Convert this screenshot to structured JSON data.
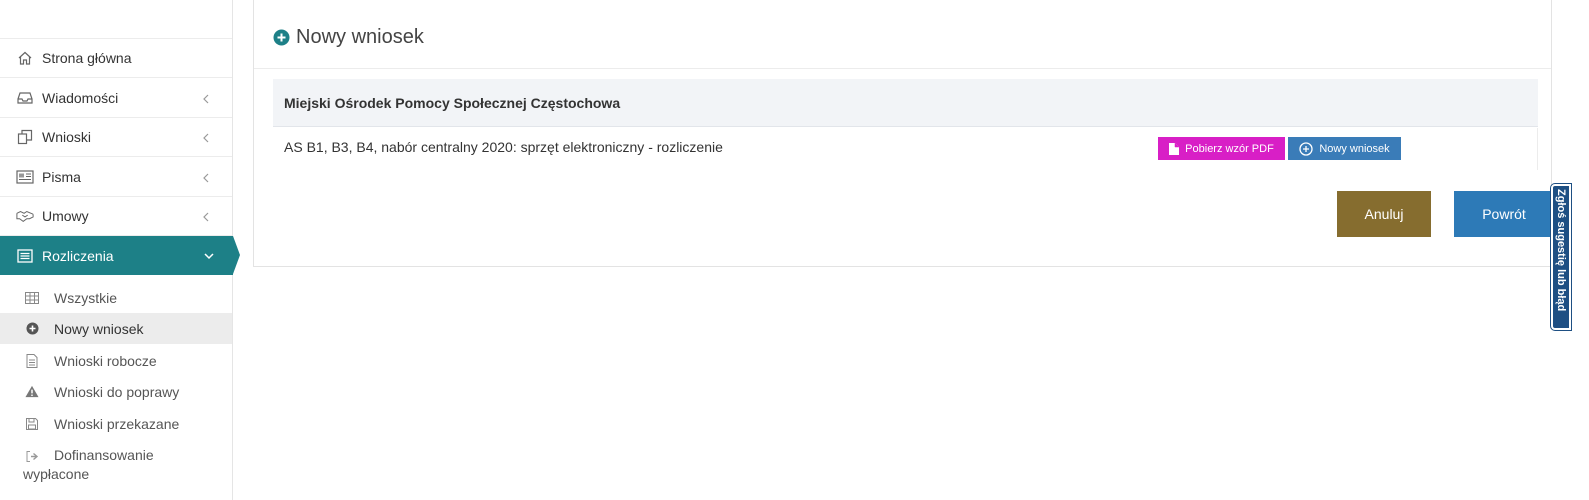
{
  "sidebar": {
    "menu": [
      {
        "label": "Strona główna",
        "icon": "home-icon",
        "has_chevron": false
      },
      {
        "label": "Wiadomości",
        "icon": "inbox-icon",
        "has_chevron": true
      },
      {
        "label": "Wnioski",
        "icon": "copy-icon",
        "has_chevron": true
      },
      {
        "label": "Pisma",
        "icon": "newspaper-icon",
        "has_chevron": true
      },
      {
        "label": "Umowy",
        "icon": "handshake-icon",
        "has_chevron": true
      },
      {
        "label": "Rozliczenia",
        "icon": "list-alt-icon",
        "has_chevron": true,
        "active": true
      }
    ],
    "submenu": [
      {
        "label": "Wszystkie",
        "icon": "table-icon"
      },
      {
        "label": "Nowy wniosek",
        "icon": "plus-circle-icon",
        "active": true
      },
      {
        "label": "Wnioski robocze",
        "icon": "file-text-icon"
      },
      {
        "label": "Wnioski do poprawy",
        "icon": "warning-icon"
      },
      {
        "label": "Wnioski przekazane",
        "icon": "floppy-icon"
      },
      {
        "label": "Dofinansowanie wypłacone",
        "icon": "sign-out-icon"
      }
    ]
  },
  "main": {
    "title": "Nowy wniosek",
    "organization": "Miejski Ośrodek Pomocy Społecznej Częstochowa",
    "rows": [
      {
        "label": "AS B1, B3, B4, nabór centralny 2020: sprzęt elektroniczny - rozliczenie",
        "pdf_button": "Pobierz wzór PDF",
        "new_button": "Nowy wniosek"
      }
    ],
    "cancel_button": "Anuluj",
    "back_button": "Powrót"
  },
  "feedback_tab": "Zgłoś sugestię lub błąd",
  "colors": {
    "accent_teal": "#1d8087",
    "pdf_magenta": "#d81fc6",
    "primary_blue": "#3a7cb8",
    "cancel_brown": "#866d2f",
    "back_blue": "#2d7ab7",
    "feedback_navy": "#1e4f83"
  }
}
